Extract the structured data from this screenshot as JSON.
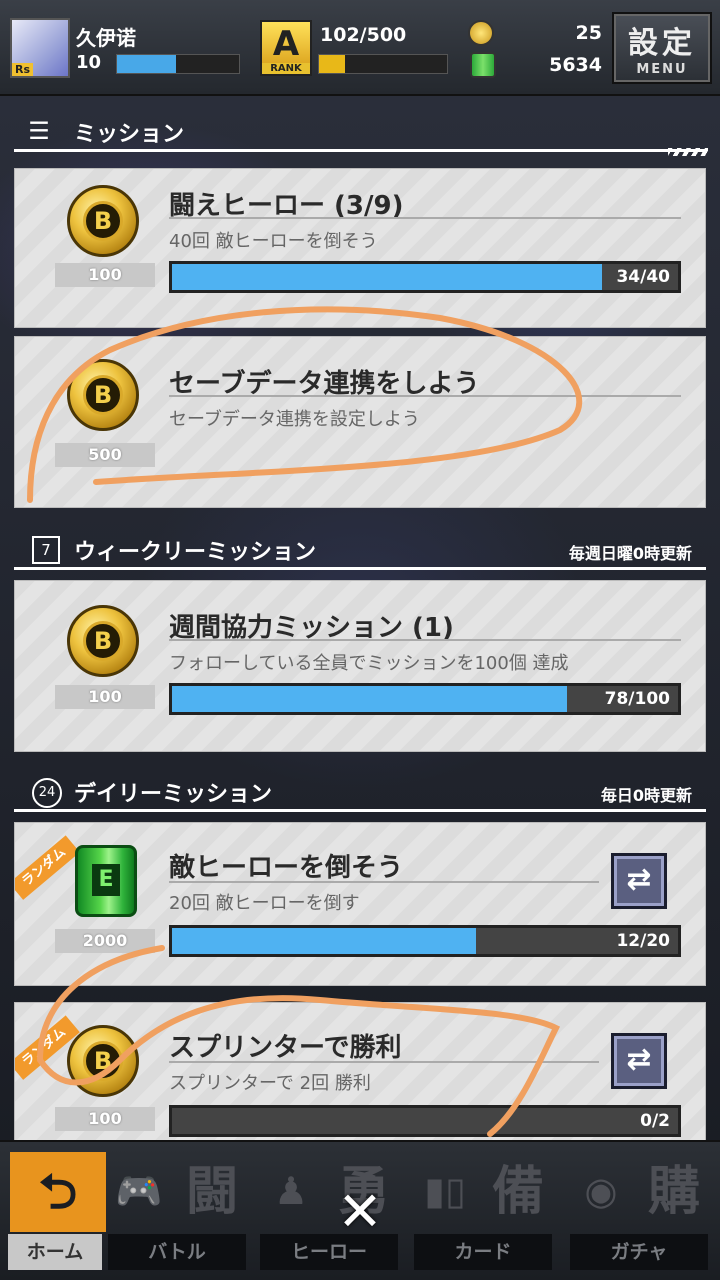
{
  "header": {
    "username": "久伊诺",
    "level": "10",
    "level_tag": "Rs",
    "xp_fill": 0.48,
    "rank_letter": "A",
    "rank_label": "RANK",
    "rank_points": "102/500",
    "rank_fill": 0.2,
    "coins": "25",
    "cans": "5634",
    "menu_kanji": "設定",
    "menu_label": "MENU"
  },
  "sections": {
    "mission": {
      "title": "ミッション"
    },
    "weekly": {
      "title": "ウィークリーミッション",
      "note": "毎週日曜0時更新",
      "icon_num": "7"
    },
    "daily": {
      "title": "デイリーミッション",
      "note": "毎日0時更新",
      "icon_num": "24"
    }
  },
  "missions": [
    {
      "title": "闘えヒーロー (3/9)",
      "desc": "40回 敵ヒーローを倒そう",
      "reward": "100",
      "reward_icon": "coin-icon",
      "progress": "34/40",
      "fill": 0.85
    },
    {
      "title": "セーブデータ連携をしよう",
      "desc": "セーブデータ連携を設定しよう",
      "reward": "500",
      "reward_icon": "coin-icon"
    },
    {
      "title": "週間協力ミッション (1)",
      "desc": "フォローしている全員でミッションを100個 達成",
      "reward": "100",
      "reward_icon": "coin-icon",
      "progress": "78/100",
      "fill": 0.78
    },
    {
      "title": "敵ヒーローを倒そう",
      "desc": "20回 敵ヒーローを倒す",
      "reward": "2000",
      "reward_icon": "can-icon",
      "progress": "12/20",
      "fill": 0.6,
      "tag": "ランダム"
    },
    {
      "title": "スプリンターで勝利",
      "desc": "スプリンターで 2回 勝利",
      "reward": "100",
      "reward_icon": "coin-icon",
      "progress": "0/2",
      "fill": 0,
      "tag": "ランダム"
    }
  ],
  "coin_letter": "B",
  "can_letter": "E",
  "nav": [
    {
      "label": "ホーム",
      "big": "⮌"
    },
    {
      "label": "バトル",
      "big": "闘"
    },
    {
      "label": "ヒーロー",
      "big": "勇"
    },
    {
      "label": "カード",
      "big": "備"
    },
    {
      "label": "ガチャ",
      "big": "購"
    }
  ],
  "close_glyph": "✕",
  "colors": {
    "accent_orange": "#f29a2c",
    "progress_blue": "#4fb2f2",
    "annotation": "#f0a060"
  }
}
